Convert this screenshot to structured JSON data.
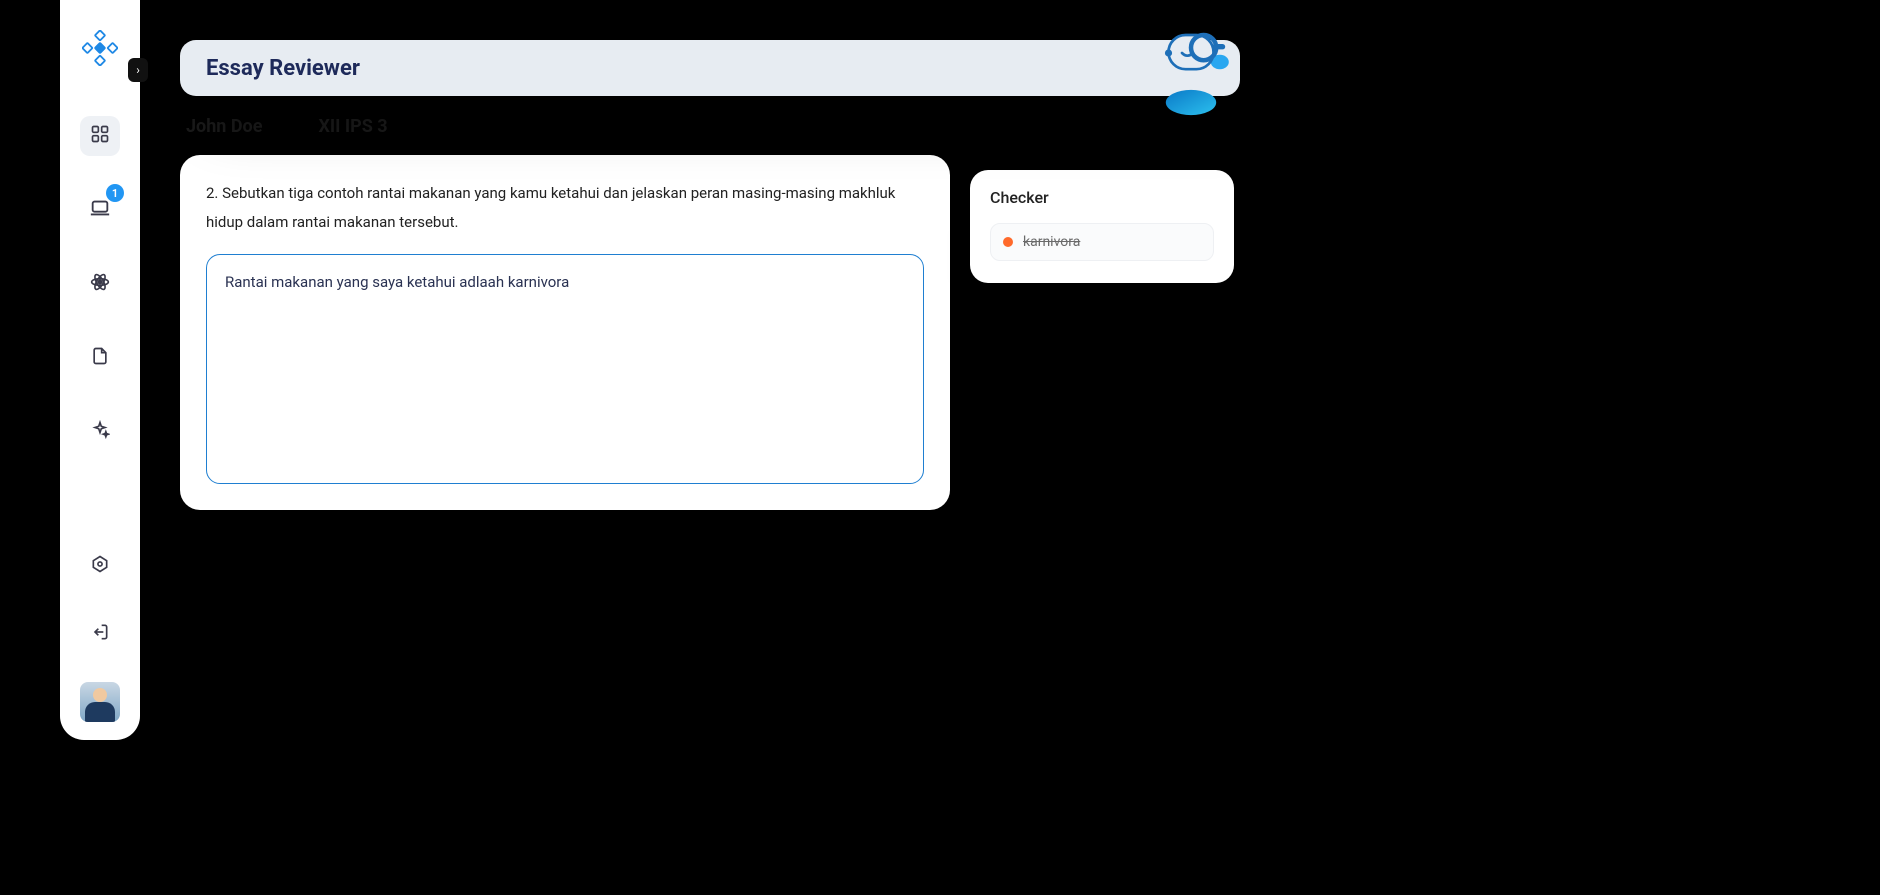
{
  "sidebar": {
    "badge": "1"
  },
  "header": {
    "title": "Essay Reviewer"
  },
  "student": {
    "name": "John Doe",
    "class": "XII IPS 3"
  },
  "question": {
    "text": "2. Sebutkan tiga contoh rantai makanan yang kamu ketahui dan jelaskan peran masing-masing makhluk hidup dalam rantai makanan tersebut."
  },
  "answer": {
    "text": "Rantai makanan yang saya ketahui adlaah karnivora"
  },
  "checker": {
    "title": "Checker",
    "items": [
      {
        "word": "karnivora",
        "status": "error"
      }
    ]
  }
}
